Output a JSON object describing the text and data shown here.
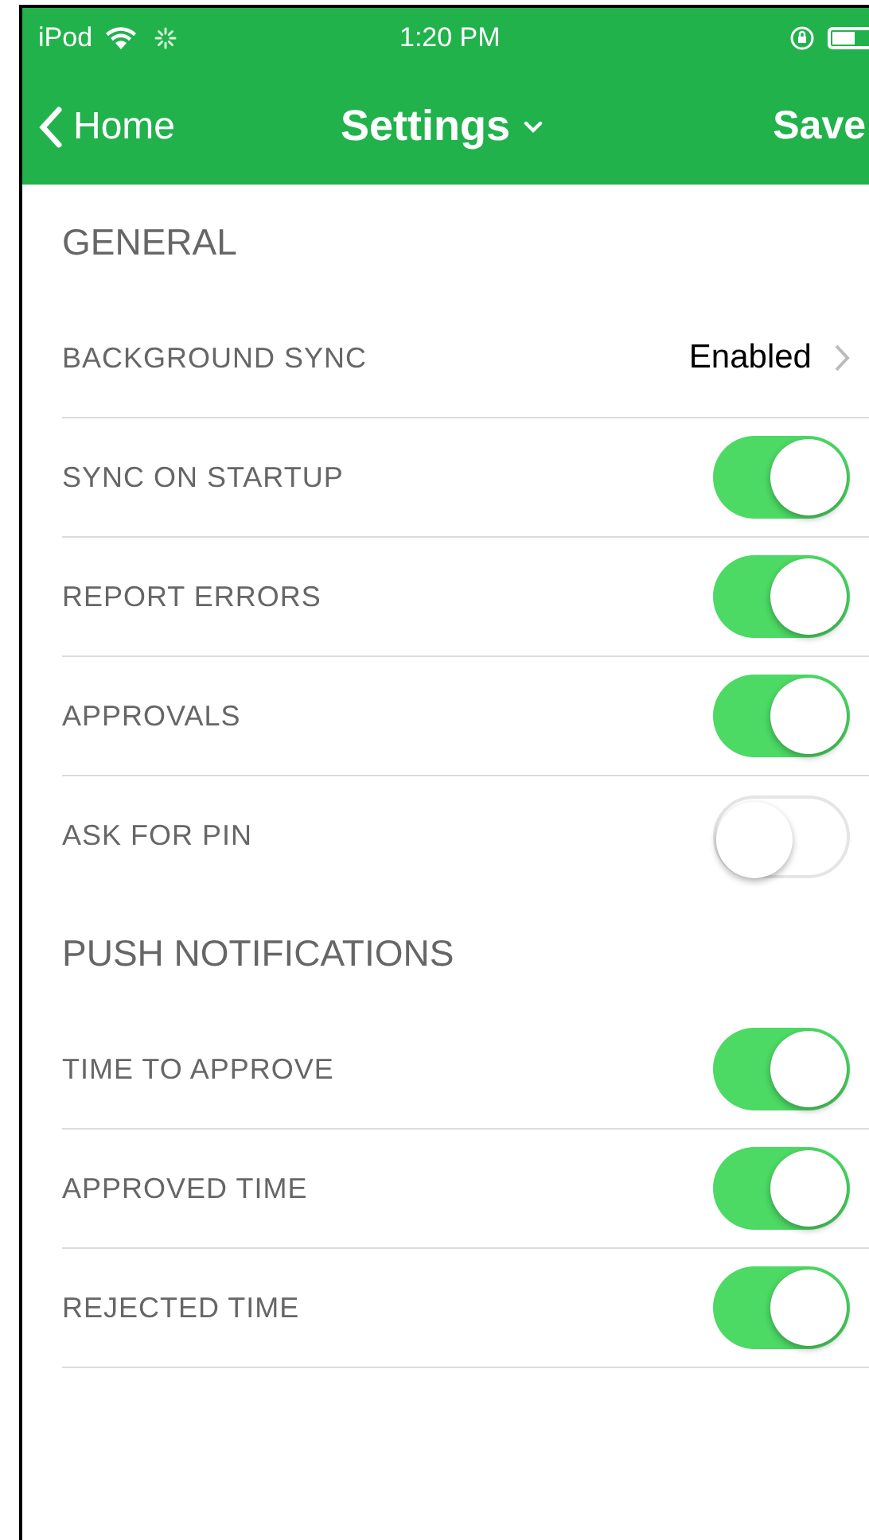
{
  "status_bar": {
    "carrier": "iPod",
    "time": "1:20 PM"
  },
  "nav": {
    "back": "Home",
    "title": "Settings",
    "action": "Save"
  },
  "sections": [
    {
      "title": "GENERAL",
      "rows": [
        {
          "kind": "link",
          "label": "BACKGROUND SYNC",
          "value": "Enabled"
        },
        {
          "kind": "toggle",
          "label": "SYNC ON STARTUP",
          "on": true
        },
        {
          "kind": "toggle",
          "label": "REPORT ERRORS",
          "on": true
        },
        {
          "kind": "toggle",
          "label": "APPROVALS",
          "on": true
        },
        {
          "kind": "toggle",
          "label": "ASK FOR PIN",
          "on": false
        }
      ]
    },
    {
      "title": "PUSH NOTIFICATIONS",
      "rows": [
        {
          "kind": "toggle",
          "label": "TIME TO APPROVE",
          "on": true
        },
        {
          "kind": "toggle",
          "label": "APPROVED TIME",
          "on": true
        },
        {
          "kind": "toggle",
          "label": "REJECTED TIME",
          "on": true
        }
      ]
    }
  ]
}
